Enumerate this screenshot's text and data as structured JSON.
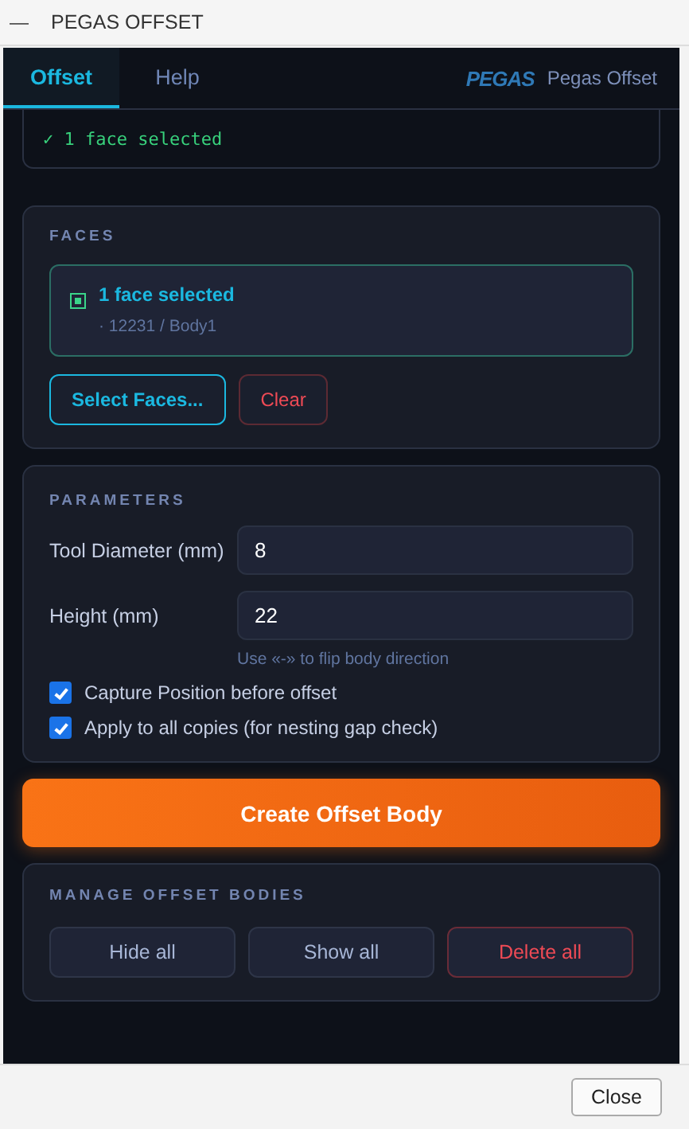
{
  "window": {
    "title": "PEGAS OFFSET",
    "minimize": "—"
  },
  "tabs": [
    {
      "label": "Offset",
      "selected": true
    },
    {
      "label": "Help",
      "selected": false
    }
  ],
  "brand": {
    "logo": "PEGAS",
    "name": "Pegas Offset"
  },
  "status": {
    "check": "✓",
    "text": "1 face selected"
  },
  "faces": {
    "heading": "FACES",
    "selection": {
      "title": "1 face selected",
      "detail": "· 12231 / Body1",
      "selected": true
    },
    "buttons": [
      {
        "label": "Select Faces...",
        "kind": "accent"
      },
      {
        "label": "Clear",
        "kind": "danger"
      }
    ]
  },
  "parameters": {
    "heading": "PARAMETERS",
    "fields": [
      {
        "label": "Tool Diameter (mm)",
        "value": "8"
      },
      {
        "label": "Height (mm)",
        "value": "22"
      }
    ],
    "hint": "Use «-» to flip body direction",
    "options": [
      {
        "label": "Capture Position before offset",
        "checked": true
      },
      {
        "label": "Apply to all copies (for nesting gap check)",
        "checked": true
      }
    ]
  },
  "create_button": "Create Offset Body",
  "manage": {
    "heading": "MANAGE OFFSET BODIES",
    "buttons": [
      {
        "label": "Hide all",
        "kind": "normal"
      },
      {
        "label": "Show all",
        "kind": "normal"
      },
      {
        "label": "Delete all",
        "kind": "danger"
      }
    ]
  },
  "footer": {
    "close": "Close"
  }
}
